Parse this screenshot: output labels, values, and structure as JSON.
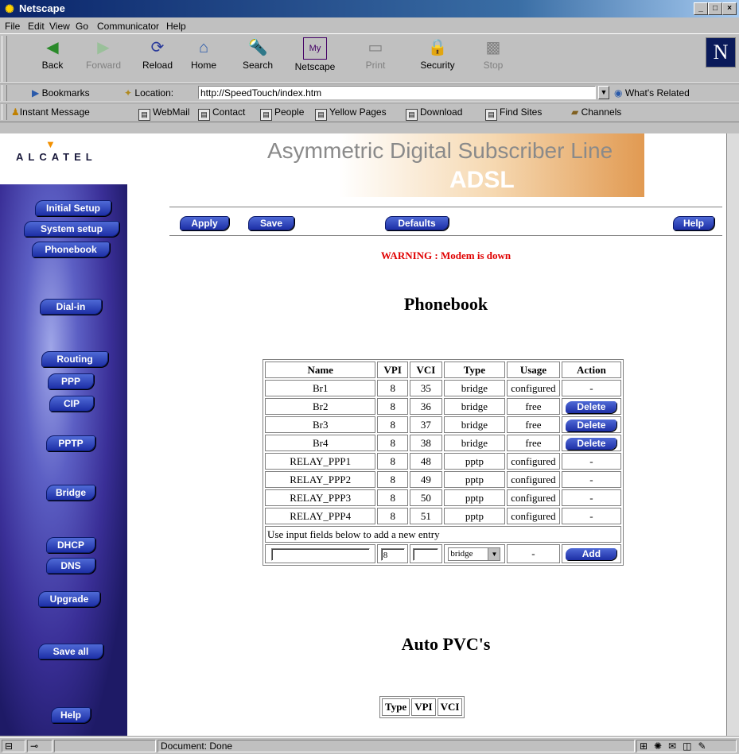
{
  "window": {
    "title": "Netscape"
  },
  "menu": [
    "File",
    "Edit",
    "View",
    "Go",
    "Communicator",
    "Help"
  ],
  "nav": [
    {
      "label": "Back",
      "icon": "back-icon",
      "enabled": true
    },
    {
      "label": "Forward",
      "icon": "forward-icon",
      "enabled": false
    },
    {
      "label": "Reload",
      "icon": "reload-icon",
      "enabled": true
    },
    {
      "label": "Home",
      "icon": "home-icon",
      "enabled": true
    },
    {
      "label": "Search",
      "icon": "search-icon",
      "enabled": true
    },
    {
      "label": "Netscape",
      "icon": "netscape-icon",
      "enabled": true
    },
    {
      "label": "Print",
      "icon": "print-icon",
      "enabled": false
    },
    {
      "label": "Security",
      "icon": "security-icon",
      "enabled": true
    },
    {
      "label": "Stop",
      "icon": "stop-icon",
      "enabled": false
    }
  ],
  "location": {
    "bookmarks": "Bookmarks",
    "label": "Location:",
    "url": "http://SpeedTouch/index.htm",
    "related": "What's Related"
  },
  "personal": [
    "Instant Message",
    "WebMail",
    "Contact",
    "People",
    "Yellow Pages",
    "Download",
    "Find Sites",
    "Channels"
  ],
  "page": {
    "logo": "ALCATEL",
    "banner_line1": "Asymmetric Digital Subscriber Line",
    "banner_line2": "ADSL",
    "sidebar": [
      "Initial Setup",
      "System setup",
      "Phonebook",
      "Dial-in",
      "Routing",
      "PPP",
      "CIP",
      "PPTP",
      "Bridge",
      "DHCP",
      "DNS",
      "Upgrade",
      "Save all",
      "Help"
    ],
    "actions": {
      "apply": "Apply",
      "save": "Save",
      "defaults": "Defaults",
      "help": "Help"
    },
    "warning": "WARNING : Modem is down",
    "title": "Phonebook",
    "table": {
      "headers": [
        "Name",
        "VPI",
        "VCI",
        "Type",
        "Usage",
        "Action"
      ],
      "rows": [
        [
          "Br1",
          "8",
          "35",
          "bridge",
          "configured",
          "-"
        ],
        [
          "Br2",
          "8",
          "36",
          "bridge",
          "free",
          "Delete"
        ],
        [
          "Br3",
          "8",
          "37",
          "bridge",
          "free",
          "Delete"
        ],
        [
          "Br4",
          "8",
          "38",
          "bridge",
          "free",
          "Delete"
        ],
        [
          "RELAY_PPP1",
          "8",
          "48",
          "pptp",
          "configured",
          "-"
        ],
        [
          "RELAY_PPP2",
          "8",
          "49",
          "pptp",
          "configured",
          "-"
        ],
        [
          "RELAY_PPP3",
          "8",
          "50",
          "pptp",
          "configured",
          "-"
        ],
        [
          "RELAY_PPP4",
          "8",
          "51",
          "pptp",
          "configured",
          "-"
        ]
      ],
      "hint": "Use input fields below to add a new entry",
      "new_entry": {
        "name": "",
        "vpi": "8",
        "vci": "",
        "type": "bridge",
        "usage": "-",
        "add": "Add"
      }
    },
    "auto_title": "Auto PVC's",
    "auto_headers": [
      "Type",
      "VPI",
      "VCI"
    ]
  },
  "status": {
    "text": "Document: Done"
  }
}
